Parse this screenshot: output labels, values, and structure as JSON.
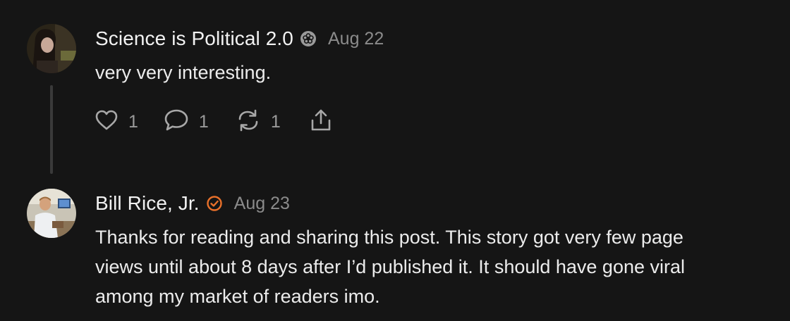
{
  "comments": [
    {
      "author": "Science is Political 2.0",
      "badge_icon": "flower-badge-icon",
      "date": "Aug 22",
      "text": "very very interesting.",
      "actions": {
        "like_count": "1",
        "reply_count": "1",
        "restack_count": "1"
      }
    },
    {
      "author": "Bill Rice, Jr.",
      "badge_icon": "check-circle-badge-icon",
      "badge_color": "#e8702a",
      "date": "Aug 23",
      "text_lines": [
        "Thanks for reading and sharing this post. This story got very few page",
        "views until about 8 days after I’d published it. It should have gone viral",
        "among my market of readers imo."
      ]
    }
  ],
  "colors": {
    "background": "#151515",
    "text": "#ececec",
    "muted": "#8b8b8b",
    "accent": "#e8702a"
  }
}
